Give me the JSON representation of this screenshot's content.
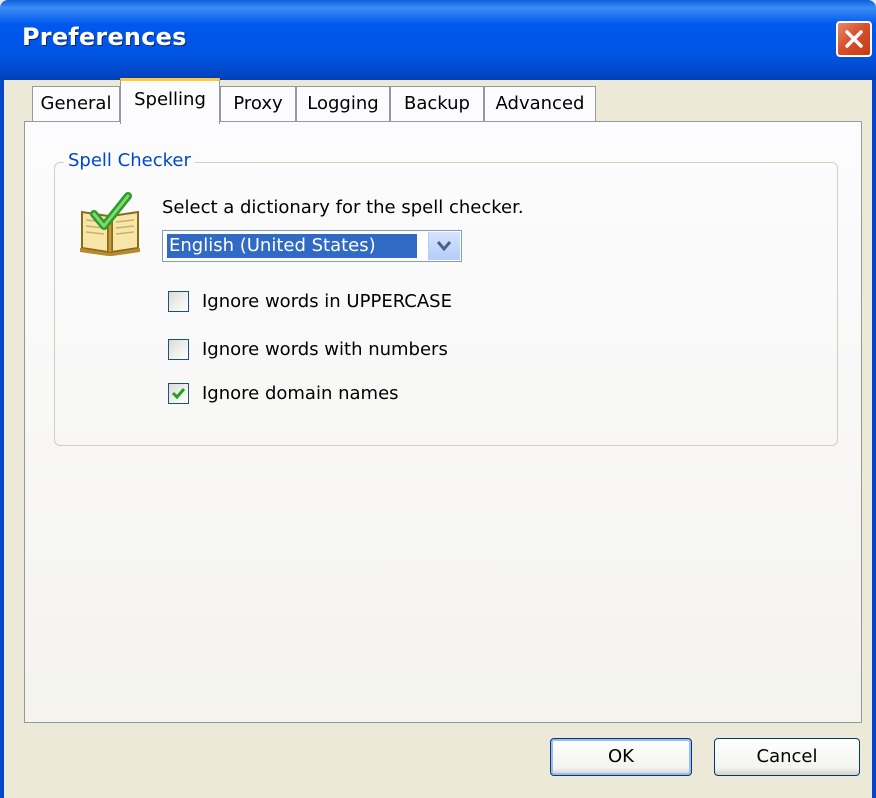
{
  "window": {
    "title": "Preferences"
  },
  "tabs": [
    {
      "label": "General"
    },
    {
      "label": "Spelling"
    },
    {
      "label": "Proxy"
    },
    {
      "label": "Logging"
    },
    {
      "label": "Backup"
    },
    {
      "label": "Advanced"
    }
  ],
  "active_tab": "Spelling",
  "spell_checker": {
    "group_title": "Spell Checker",
    "instruction": "Select a dictionary for the spell checker.",
    "dictionary_selected": "English (United States)",
    "options": [
      {
        "label": "Ignore words in UPPERCASE",
        "checked": false
      },
      {
        "label": "Ignore words with numbers",
        "checked": false
      },
      {
        "label": "Ignore domain names",
        "checked": true
      }
    ]
  },
  "buttons": {
    "ok": "OK",
    "cancel": "Cancel"
  },
  "icons": {
    "close": "close-icon",
    "dropdown": "chevron-down-icon",
    "spell": "book-check-icon"
  },
  "colors": {
    "title_bar": "#0054e3",
    "group_title": "#0046d5",
    "selection": "#316ac5",
    "check_mark": "#21a121"
  }
}
